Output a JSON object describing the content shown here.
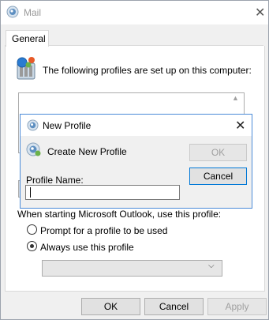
{
  "window": {
    "title": "Mail",
    "close_glyph": "✕"
  },
  "tabs": [
    {
      "label": "General"
    }
  ],
  "general": {
    "profiles_text": "The following profiles are set up on this computer:",
    "startup_text": "When starting Microsoft Outlook, use this profile:",
    "radio_prompt": "Prompt for a profile to be used",
    "radio_always": "Always use this profile",
    "selected_radio": "always",
    "profile_dropdown_value": ""
  },
  "footer": {
    "ok": "OK",
    "cancel": "Cancel",
    "apply": "Apply"
  },
  "new_profile_dialog": {
    "title": "New Profile",
    "subtitle": "Create New Profile",
    "name_label": "Profile Name:",
    "name_value": "",
    "ok": "OK",
    "cancel": "Cancel",
    "close_glyph": "✕"
  },
  "colors": {
    "dialog_border": "#4b8bd8",
    "default_button_border": "#0078d7"
  }
}
